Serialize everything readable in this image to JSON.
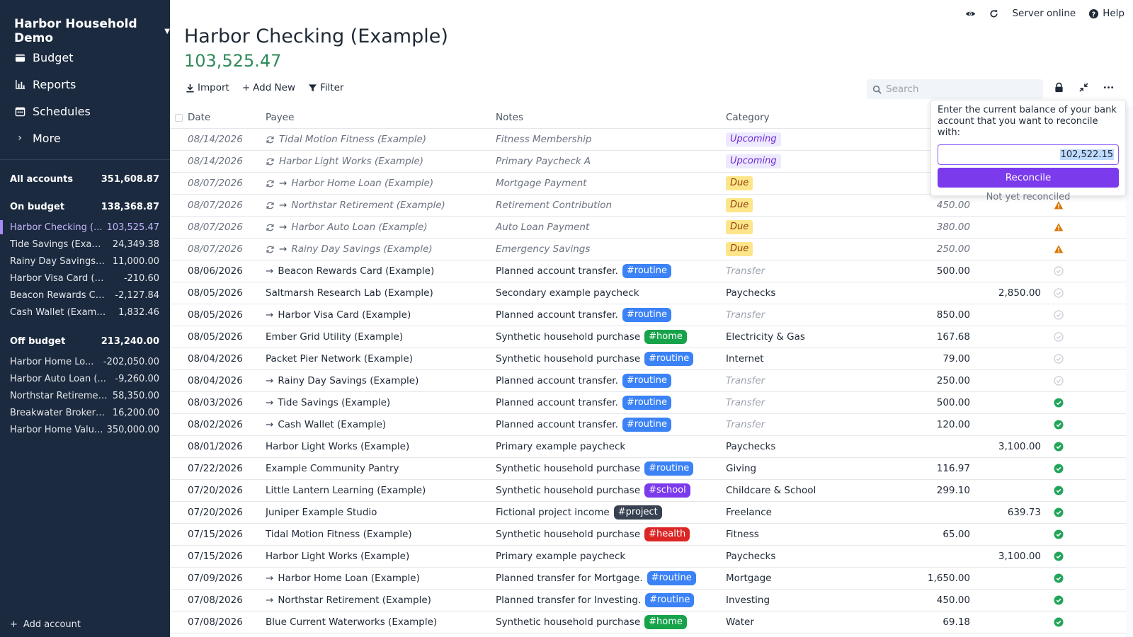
{
  "sidebar": {
    "budget_name": "Harbor Household Demo",
    "nav": [
      {
        "label": "Budget",
        "icon": "wallet-icon"
      },
      {
        "label": "Reports",
        "icon": "chart-icon"
      },
      {
        "label": "Schedules",
        "icon": "calendar-icon"
      },
      {
        "label": "More",
        "icon": "chevron-right-icon"
      }
    ],
    "all_accounts": {
      "label": "All accounts",
      "value": "351,608.87"
    },
    "on_budget": {
      "label": "On budget",
      "value": "138,368.87"
    },
    "on_budget_accounts": [
      {
        "name": "Harbor Checking (...",
        "value": "103,525.47"
      },
      {
        "name": "Tide Savings (Exam...",
        "value": "24,349.38"
      },
      {
        "name": "Rainy Day Savings (...",
        "value": "11,000.00"
      },
      {
        "name": "Harbor Visa Card (Ex...",
        "value": "-210.60"
      },
      {
        "name": "Beacon Rewards Ca...",
        "value": "-2,127.84"
      },
      {
        "name": "Cash Wallet (Example)",
        "value": "1,832.46"
      }
    ],
    "off_budget": {
      "label": "Off budget",
      "value": "213,240.00"
    },
    "off_budget_accounts": [
      {
        "name": "Harbor Home Lo...",
        "value": "-202,050.00"
      },
      {
        "name": "Harbor Auto Loan (...",
        "value": "-9,260.00"
      },
      {
        "name": "Northstar Retiremen...",
        "value": "58,350.00"
      },
      {
        "name": "Breakwater Brokera...",
        "value": "16,200.00"
      },
      {
        "name": "Harbor Home Valu...",
        "value": "350,000.00"
      }
    ],
    "add_account": "Add account"
  },
  "topbar": {
    "server_status": "Server online",
    "help": "Help"
  },
  "account": {
    "title": "Harbor Checking (Example)",
    "balance": "103,525.47"
  },
  "toolbar": {
    "import": "Import",
    "add_new": "Add New",
    "filter": "Filter",
    "search_placeholder": "Search"
  },
  "columns": {
    "date": "Date",
    "payee": "Payee",
    "notes": "Notes",
    "category": "Category"
  },
  "reconcile": {
    "prompt": "Enter the current balance of your bank account that you want to reconcile with:",
    "input_value": "102,522.15",
    "button": "Reconcile",
    "not_reconciled": "Not yet reconciled"
  },
  "colors": {
    "accent": "#7c3aed",
    "sidebar": "#1b2a3f",
    "balance": "#2f8a5a",
    "tag_blue": "#3b82f6",
    "tag_green": "#16a34a",
    "tag_purple": "#7c3aed",
    "tag_dark": "#374151",
    "tag_red": "#dc2626"
  },
  "transactions": [
    {
      "date": "08/14/2026",
      "payee": "Tidal Motion Fitness (Example)",
      "recurring": true,
      "transfer": false,
      "notes": "Fitness Membership",
      "tag": "",
      "tag_color": "",
      "category": "Upcoming",
      "cat_type": "upcoming",
      "payment": "",
      "deposit": "",
      "status": "none",
      "scheduled": true
    },
    {
      "date": "08/14/2026",
      "payee": "Harbor Light Works (Example)",
      "recurring": true,
      "transfer": false,
      "notes": "Primary Paycheck A",
      "tag": "",
      "tag_color": "",
      "category": "Upcoming",
      "cat_type": "upcoming",
      "payment": "",
      "deposit": "",
      "status": "none",
      "scheduled": true
    },
    {
      "date": "08/07/2026",
      "payee": "Harbor Home Loan (Example)",
      "recurring": true,
      "transfer": true,
      "notes": "Mortgage Payment",
      "tag": "",
      "tag_color": "",
      "category": "Due",
      "cat_type": "due",
      "payment": "",
      "deposit": "",
      "status": "none",
      "scheduled": true
    },
    {
      "date": "08/07/2026",
      "payee": "Northstar Retirement (Example)",
      "recurring": true,
      "transfer": true,
      "notes": "Retirement Contribution",
      "tag": "",
      "tag_color": "",
      "category": "Due",
      "cat_type": "due",
      "payment": "450.00",
      "deposit": "",
      "status": "warning",
      "scheduled": true
    },
    {
      "date": "08/07/2026",
      "payee": "Harbor Auto Loan (Example)",
      "recurring": true,
      "transfer": true,
      "notes": "Auto Loan Payment",
      "tag": "",
      "tag_color": "",
      "category": "Due",
      "cat_type": "due",
      "payment": "380.00",
      "deposit": "",
      "status": "warning",
      "scheduled": true
    },
    {
      "date": "08/07/2026",
      "payee": "Rainy Day Savings (Example)",
      "recurring": true,
      "transfer": true,
      "notes": "Emergency Savings",
      "tag": "",
      "tag_color": "",
      "category": "Due",
      "cat_type": "due",
      "payment": "250.00",
      "deposit": "",
      "status": "warning",
      "scheduled": true
    },
    {
      "date": "08/06/2026",
      "payee": "Beacon Rewards Card (Example)",
      "recurring": false,
      "transfer": true,
      "notes": "Planned account transfer.",
      "tag": "#routine",
      "tag_color": "#3b82f6",
      "category": "Transfer",
      "cat_type": "transfer",
      "payment": "500.00",
      "deposit": "",
      "status": "uncleared",
      "scheduled": false
    },
    {
      "date": "08/05/2026",
      "payee": "Saltmarsh Research Lab (Example)",
      "recurring": false,
      "transfer": false,
      "notes": "Secondary example paycheck",
      "tag": "",
      "tag_color": "",
      "category": "Paychecks",
      "cat_type": "normal",
      "payment": "",
      "deposit": "2,850.00",
      "status": "uncleared",
      "scheduled": false
    },
    {
      "date": "08/05/2026",
      "payee": "Harbor Visa Card (Example)",
      "recurring": false,
      "transfer": true,
      "notes": "Planned account transfer.",
      "tag": "#routine",
      "tag_color": "#3b82f6",
      "category": "Transfer",
      "cat_type": "transfer",
      "payment": "850.00",
      "deposit": "",
      "status": "uncleared",
      "scheduled": false
    },
    {
      "date": "08/05/2026",
      "payee": "Ember Grid Utility (Example)",
      "recurring": false,
      "transfer": false,
      "notes": "Synthetic household purchase",
      "tag": "#home",
      "tag_color": "#16a34a",
      "category": "Electricity & Gas",
      "cat_type": "normal",
      "payment": "167.68",
      "deposit": "",
      "status": "uncleared",
      "scheduled": false
    },
    {
      "date": "08/04/2026",
      "payee": "Packet Pier Network (Example)",
      "recurring": false,
      "transfer": false,
      "notes": "Synthetic household purchase",
      "tag": "#routine",
      "tag_color": "#3b82f6",
      "category": "Internet",
      "cat_type": "normal",
      "payment": "79.00",
      "deposit": "",
      "status": "uncleared",
      "scheduled": false
    },
    {
      "date": "08/04/2026",
      "payee": "Rainy Day Savings (Example)",
      "recurring": false,
      "transfer": true,
      "notes": "Planned account transfer.",
      "tag": "#routine",
      "tag_color": "#3b82f6",
      "category": "Transfer",
      "cat_type": "transfer",
      "payment": "250.00",
      "deposit": "",
      "status": "uncleared",
      "scheduled": false
    },
    {
      "date": "08/03/2026",
      "payee": "Tide Savings (Example)",
      "recurring": false,
      "transfer": true,
      "notes": "Planned account transfer.",
      "tag": "#routine",
      "tag_color": "#3b82f6",
      "category": "Transfer",
      "cat_type": "transfer",
      "payment": "500.00",
      "deposit": "",
      "status": "cleared",
      "scheduled": false
    },
    {
      "date": "08/02/2026",
      "payee": "Cash Wallet (Example)",
      "recurring": false,
      "transfer": true,
      "notes": "Planned account transfer.",
      "tag": "#routine",
      "tag_color": "#3b82f6",
      "category": "Transfer",
      "cat_type": "transfer",
      "payment": "120.00",
      "deposit": "",
      "status": "cleared",
      "scheduled": false
    },
    {
      "date": "08/01/2026",
      "payee": "Harbor Light Works (Example)",
      "recurring": false,
      "transfer": false,
      "notes": "Primary example paycheck",
      "tag": "",
      "tag_color": "",
      "category": "Paychecks",
      "cat_type": "normal",
      "payment": "",
      "deposit": "3,100.00",
      "status": "cleared",
      "scheduled": false
    },
    {
      "date": "07/22/2026",
      "payee": "Example Community Pantry",
      "recurring": false,
      "transfer": false,
      "notes": "Synthetic household purchase",
      "tag": "#routine",
      "tag_color": "#3b82f6",
      "category": "Giving",
      "cat_type": "normal",
      "payment": "116.97",
      "deposit": "",
      "status": "cleared",
      "scheduled": false
    },
    {
      "date": "07/20/2026",
      "payee": "Little Lantern Learning (Example)",
      "recurring": false,
      "transfer": false,
      "notes": "Synthetic household purchase",
      "tag": "#school",
      "tag_color": "#7c3aed",
      "category": "Childcare & School",
      "cat_type": "normal",
      "payment": "299.10",
      "deposit": "",
      "status": "cleared",
      "scheduled": false
    },
    {
      "date": "07/20/2026",
      "payee": "Juniper Example Studio",
      "recurring": false,
      "transfer": false,
      "notes": "Fictional project income",
      "tag": "#project",
      "tag_color": "#374151",
      "category": "Freelance",
      "cat_type": "normal",
      "payment": "",
      "deposit": "639.73",
      "status": "cleared",
      "scheduled": false
    },
    {
      "date": "07/15/2026",
      "payee": "Tidal Motion Fitness (Example)",
      "recurring": false,
      "transfer": false,
      "notes": "Synthetic household purchase",
      "tag": "#health",
      "tag_color": "#dc2626",
      "category": "Fitness",
      "cat_type": "normal",
      "payment": "65.00",
      "deposit": "",
      "status": "cleared",
      "scheduled": false
    },
    {
      "date": "07/15/2026",
      "payee": "Harbor Light Works (Example)",
      "recurring": false,
      "transfer": false,
      "notes": "Primary example paycheck",
      "tag": "",
      "tag_color": "",
      "category": "Paychecks",
      "cat_type": "normal",
      "payment": "",
      "deposit": "3,100.00",
      "status": "cleared",
      "scheduled": false
    },
    {
      "date": "07/09/2026",
      "payee": "Harbor Home Loan (Example)",
      "recurring": false,
      "transfer": true,
      "notes": "Planned transfer for Mortgage.",
      "tag": "#routine",
      "tag_color": "#3b82f6",
      "category": "Mortgage",
      "cat_type": "normal",
      "payment": "1,650.00",
      "deposit": "",
      "status": "cleared",
      "scheduled": false
    },
    {
      "date": "07/08/2026",
      "payee": "Northstar Retirement (Example)",
      "recurring": false,
      "transfer": true,
      "notes": "Planned transfer for Investing.",
      "tag": "#routine",
      "tag_color": "#3b82f6",
      "category": "Investing",
      "cat_type": "normal",
      "payment": "450.00",
      "deposit": "",
      "status": "cleared",
      "scheduled": false
    },
    {
      "date": "07/08/2026",
      "payee": "Blue Current Waterworks (Example)",
      "recurring": false,
      "transfer": false,
      "notes": "Synthetic household purchase",
      "tag": "#home",
      "tag_color": "#16a34a",
      "category": "Water",
      "cat_type": "normal",
      "payment": "69.18",
      "deposit": "",
      "status": "cleared",
      "scheduled": false
    }
  ]
}
